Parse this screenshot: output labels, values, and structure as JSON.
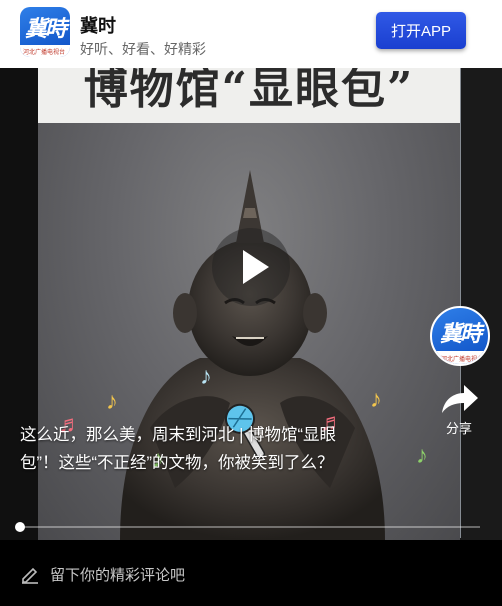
{
  "banner": {
    "app_name": "冀时",
    "slogan": "好听、好看、好精彩",
    "open_button": "打开APP",
    "logo_glyph": "冀時",
    "logo_subtext": "河北广播电视台"
  },
  "video": {
    "poster_title": "博物馆“显眼包”",
    "caption": "这么近，那么美，周末到河北 | 博物馆“显眼包”！这些“不正经”的文物，你被笑到了么？",
    "progress_percent": 0,
    "play_icon": "play-icon"
  },
  "sidebar": {
    "share_label": "分享",
    "share_icon": "share-arrow-icon"
  },
  "comment": {
    "placeholder": "留下你的精彩评论吧",
    "icon": "pencil-icon"
  },
  "colors": {
    "open_button": "#1f46d6",
    "logo_blue": "#1a62d8"
  }
}
